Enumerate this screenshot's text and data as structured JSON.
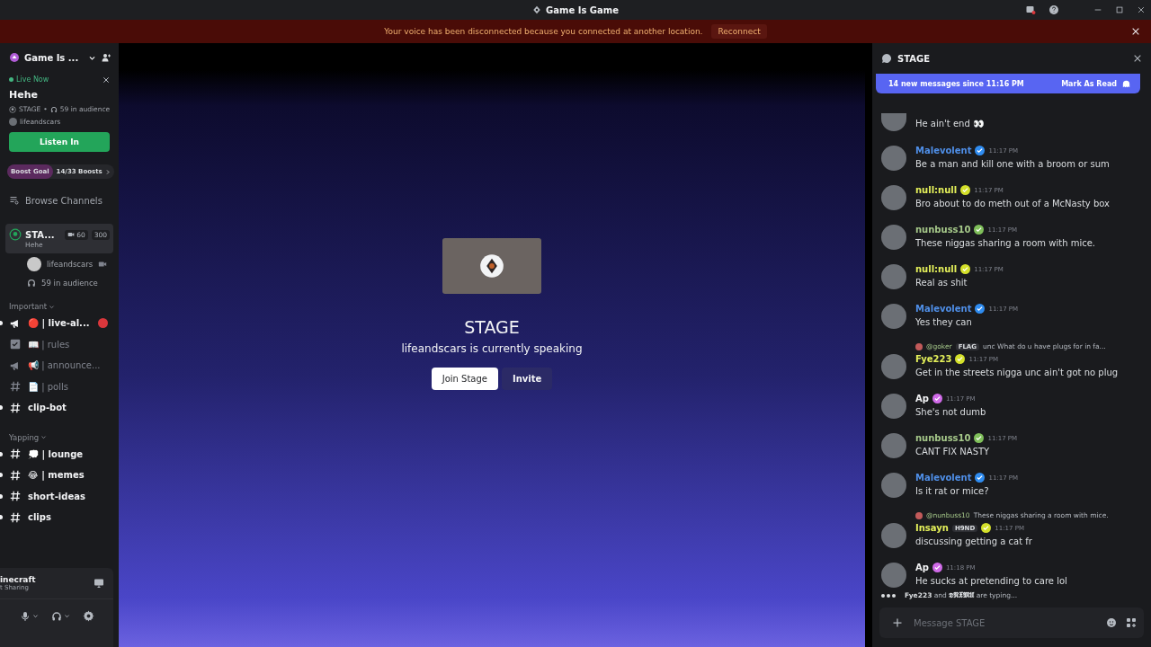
{
  "window": {
    "title": "Game Is Game"
  },
  "banner": {
    "text": "Your voice has been disconnected because you connected at another location.",
    "action": "Reconnect"
  },
  "server": {
    "name": "Game Is ..."
  },
  "live": {
    "badge": "Live Now",
    "title": "Hehe",
    "channel": "STAGE",
    "separator": "•",
    "audience": "59 in audience",
    "speaker": "lifeandscars",
    "button": "Listen In"
  },
  "boost": {
    "label": "Boost Goal",
    "progress": "14/33 Boosts"
  },
  "browse": "Browse Channels",
  "voice_channel": {
    "name": "STA...",
    "topic": "Hehe",
    "video_count": "60",
    "limit": "300",
    "speaker": "lifeandscars",
    "audience": "59 in audience",
    "selected": true
  },
  "categories": [
    {
      "name": "Important",
      "channels": [
        {
          "kind": "announcement",
          "name": "🔴 | live-al...",
          "unread": true,
          "mention": true
        },
        {
          "kind": "rules",
          "name": "📖 | rules",
          "unread": false,
          "mention": false
        },
        {
          "kind": "announcement",
          "name": "📢 | announce...",
          "unread": false,
          "mention": false
        },
        {
          "kind": "text",
          "name": "📄 | polls",
          "unread": false,
          "mention": false
        },
        {
          "kind": "text",
          "name": "clip-bot",
          "unread": true,
          "mention": false
        }
      ]
    },
    {
      "name": "Yapping",
      "channels": [
        {
          "kind": "text",
          "name": "💭 | lounge",
          "unread": true,
          "mention": false
        },
        {
          "kind": "text",
          "name": "😂 | memes",
          "unread": true,
          "mention": false
        },
        {
          "kind": "text",
          "name": "short-ideas",
          "unread": true,
          "mention": false
        },
        {
          "kind": "text",
          "name": "clips",
          "unread": true,
          "mention": false
        }
      ]
    }
  ],
  "activity": {
    "title": "inecraft",
    "subtitle": "t Sharing"
  },
  "stage": {
    "title": "STAGE",
    "subtitle": "lifeandscars is currently speaking",
    "buttons": [
      "Join Stage",
      "Invite"
    ]
  },
  "chat": {
    "title": "STAGE",
    "new_bar": "14 new messages since 11:16 PM",
    "mark_read": "Mark As Read",
    "messages": [
      {
        "text": "He ain't end 👀"
      },
      {
        "author": "Malevolent",
        "color": "#4f8fe8",
        "badge": {
          "color": "#2f8cf0"
        },
        "time": "11:17 PM",
        "text": "Be a man and kill one with a broom or sum"
      },
      {
        "author": "null:null",
        "color": "#e4f05a",
        "badge": {
          "color": "#d4e02a"
        },
        "time": "11:17 PM",
        "text": "Bro about to do meth out of a McNasty box"
      },
      {
        "author": "nunbuss10",
        "color": "#a6c98a",
        "badge": {
          "color": "#7fbf5a"
        },
        "time": "11:17 PM",
        "text": "These niggas sharing a room with mice."
      },
      {
        "author": "null:null",
        "color": "#e4f05a",
        "badge": {
          "color": "#d4e02a"
        },
        "time": "11:17 PM",
        "text": "Real as shit"
      },
      {
        "author": "Malevolent",
        "color": "#4f8fe8",
        "badge": {
          "color": "#2f8cf0"
        },
        "time": "11:17 PM",
        "text": "Yes they can"
      },
      {
        "author": "Fye223",
        "color": "#e4f05a",
        "badge": {
          "color": "#d4e02a"
        },
        "time": "11:17 PM",
        "text": "Get in the streets nigga unc ain't got no plug",
        "reply": {
          "author": "@goker",
          "tag": "FLAG",
          "text": "unc What do u have plugs for in fa..."
        }
      },
      {
        "author": "Ap",
        "color": "#f2f3f5",
        "badge": {
          "color": "#d06ae8"
        },
        "time": "11:17 PM",
        "text": "She's not dumb"
      },
      {
        "author": "nunbuss10",
        "color": "#a6c98a",
        "badge": {
          "color": "#7fbf5a"
        },
        "time": "11:17 PM",
        "text": "CANT FIX NASTY"
      },
      {
        "author": "Malevolent",
        "color": "#4f8fe8",
        "badge": {
          "color": "#2f8cf0"
        },
        "time": "11:17 PM",
        "text": "Is it rat or mice?"
      },
      {
        "author": "Insayn",
        "color": "#e4f05a",
        "badge": {
          "color": "#d4e02a"
        },
        "time": "11:17 PM",
        "tag": "H9ND",
        "text": "discussing getting a cat fr",
        "reply": {
          "author": "@nunbuss10",
          "text": "These niggas sharing a room with mice."
        }
      },
      {
        "author": "Ap",
        "color": "#f2f3f5",
        "badge": {
          "color": "#d06ae8"
        },
        "time": "11:18 PM",
        "text": "He sucks at pretending to care lol"
      }
    ],
    "typing": {
      "names": [
        "Fye223",
        "𝕯𝕹𝖃𝕸𝖀"
      ],
      "joiner": "and",
      "suffix": "are typing..."
    },
    "input_placeholder": "Message STAGE"
  }
}
